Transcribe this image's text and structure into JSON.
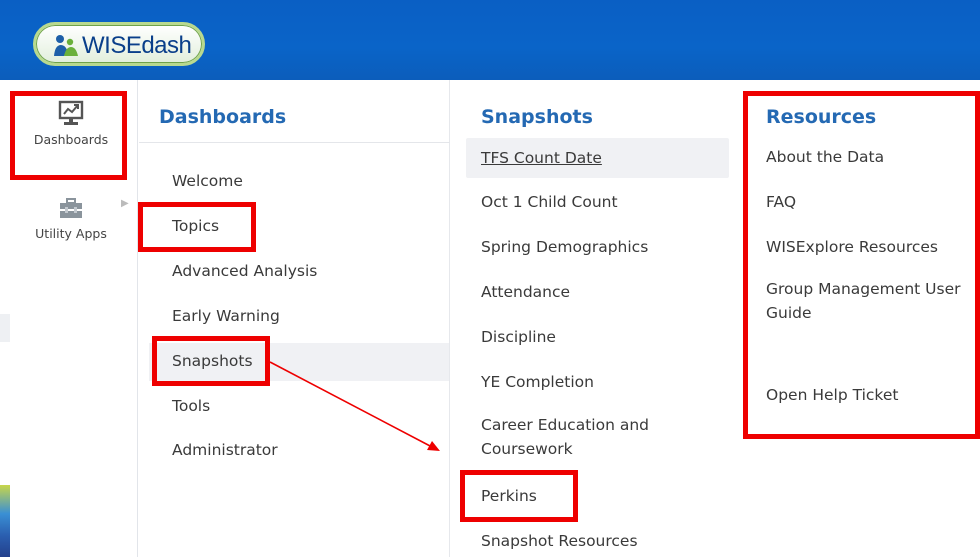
{
  "header": {
    "logo_text": "WISEdash",
    "colors": {
      "header_blue": "#0a64c8",
      "title_blue": "#2469b3",
      "annotation_red": "#ee0000"
    }
  },
  "rail": {
    "items": [
      {
        "label": "Dashboards",
        "icon": "monitor-chart-icon"
      },
      {
        "label": "Utility Apps",
        "icon": "toolbox-icon"
      }
    ]
  },
  "dashboards": {
    "title": "Dashboards",
    "items": [
      "Welcome",
      "Topics",
      "Advanced Analysis",
      "Early Warning",
      "Snapshots",
      "Tools",
      "Administrator"
    ]
  },
  "snapshots": {
    "title": "Snapshots",
    "items": [
      "TFS Count Date",
      "Oct 1 Child Count",
      "Spring Demographics",
      "Attendance",
      "Discipline",
      "YE Completion",
      "Career Education and Coursework",
      "Perkins",
      "Snapshot Resources"
    ]
  },
  "resources": {
    "title": "Resources",
    "items": [
      "About the Data",
      "FAQ",
      "WISExplore Resources",
      "Group Management User Guide",
      "Open Help Ticket"
    ]
  }
}
